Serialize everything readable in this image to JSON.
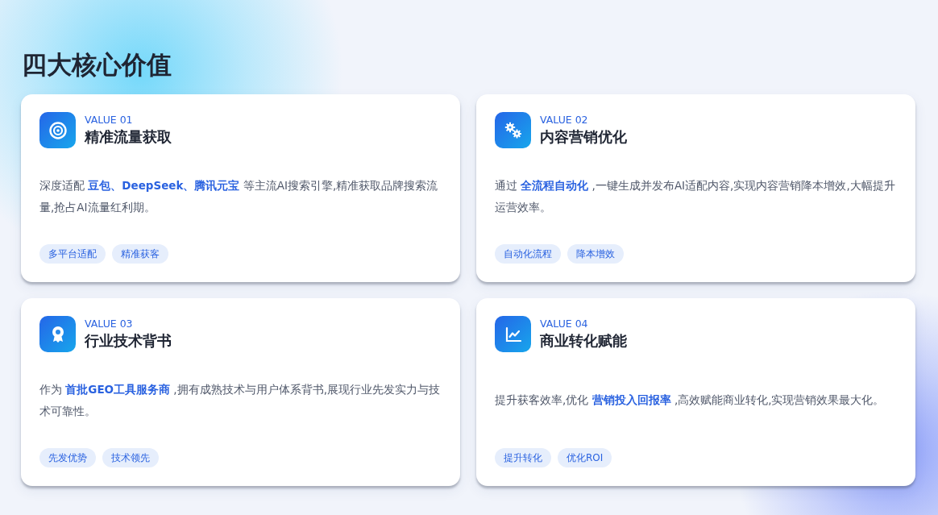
{
  "heading": "四大核心价值",
  "cards": [
    {
      "label": "VALUE 01",
      "title": "精准流量获取",
      "description": "深度适配 **豆包、DeepSeek、腾讯元宝** 等主流AI搜索引擎,精准获取品牌搜索流量,抢占AI流量红利期。",
      "tags": [
        "多平台适配",
        "精准获客"
      ]
    },
    {
      "label": "VALUE 02",
      "title": "内容营销优化",
      "description": "通过 **全流程自动化** ,一键生成并发布AI适配内容,实现内容营销降本增效,大幅提升运营效率。",
      "tags": [
        "自动化流程",
        "降本增效"
      ]
    },
    {
      "label": "VALUE 03",
      "title": "行业技术背书",
      "description": "作为 **首批GEO工具服务商** ,拥有成熟技术与用户体系背书,展现行业先发实力与技术可靠性。",
      "tags": [
        "先发优势",
        "技术领先"
      ]
    },
    {
      "label": "VALUE 04",
      "title": "商业转化赋能",
      "description": "提升获客效率,优化 **营销投入回报率** ,高效赋能商业转化,实现营销效果最大化。",
      "tags": [
        "提升转化",
        "优化ROI"
      ]
    }
  ]
}
